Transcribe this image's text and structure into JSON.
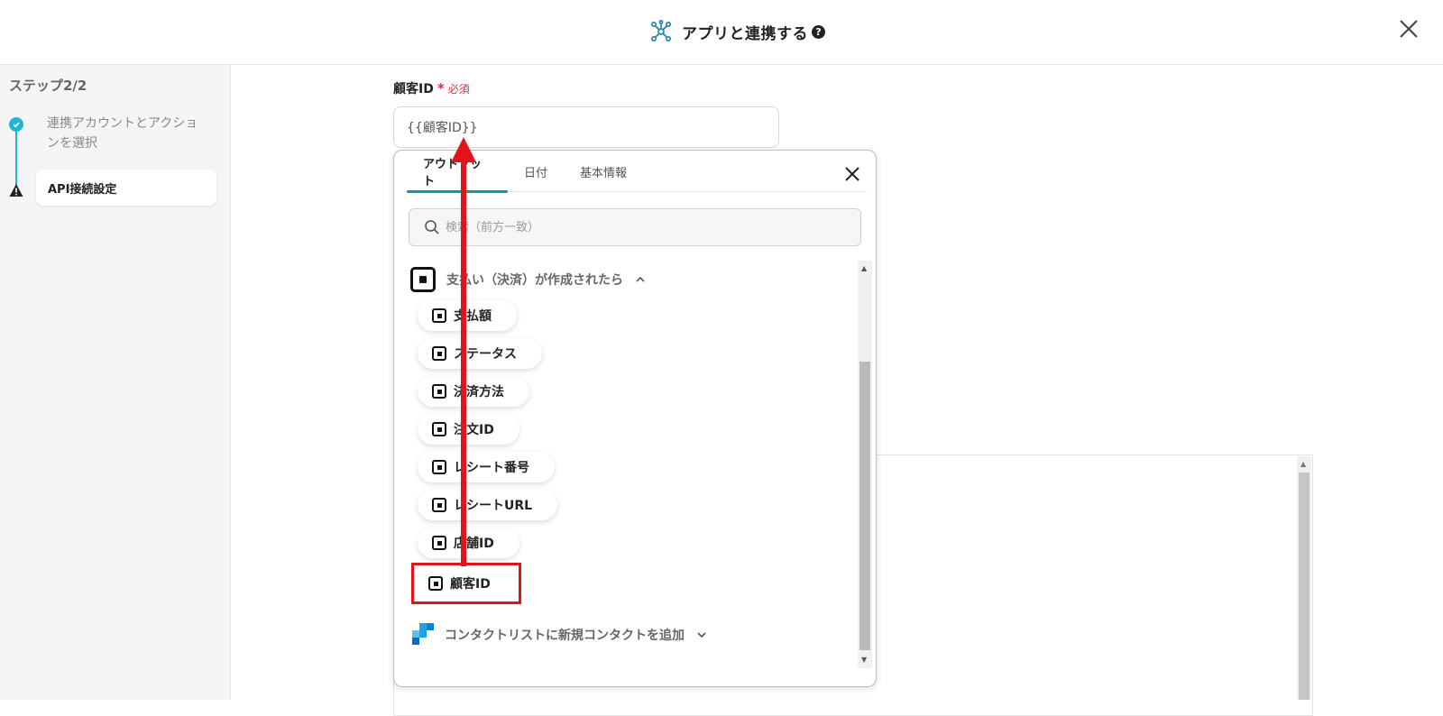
{
  "header": {
    "title": "アプリと連携する",
    "help_icon_glyph": "?"
  },
  "sidebar": {
    "step_count": "ステップ2/2",
    "steps": [
      {
        "label": "連携アカウントとアクションを選択",
        "status": "done"
      },
      {
        "label": "API接続設定",
        "status": "warning"
      }
    ]
  },
  "form": {
    "field_label": "顧客ID",
    "required_mark": "*",
    "required_text": "必須",
    "field_value": "{{顧客ID}}"
  },
  "popup": {
    "tabs": [
      {
        "label": "アウトプット",
        "active": true
      },
      {
        "label": "日付",
        "active": false
      },
      {
        "label": "基本情報",
        "active": false
      }
    ],
    "search_placeholder": "検索（前方一致）",
    "groups": [
      {
        "title": "支払い（決済）が作成されたら",
        "icon": "square-logo",
        "expanded": true,
        "items": [
          "支払額",
          "ステータス",
          "決済方法",
          "注文ID",
          "レシート番号",
          "レシートURL",
          "店舗ID",
          "顧客ID"
        ]
      },
      {
        "title": "コンタクトリストに新規コンタクトを追加",
        "icon": "blocks-logo",
        "expanded": false
      }
    ],
    "highlighted_item": "顧客ID"
  },
  "colors": {
    "accent": "#1fb6d4",
    "tab_underline": "#1a8fb3",
    "required": "#e0314b",
    "annotation": "#e0141a"
  }
}
